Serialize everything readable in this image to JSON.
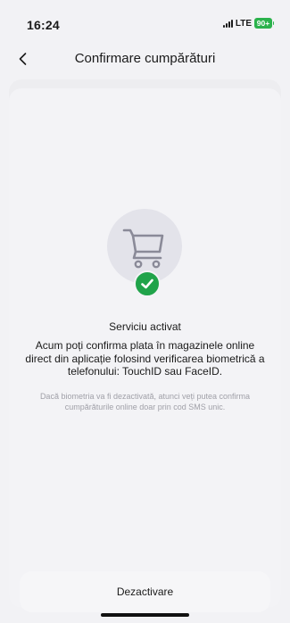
{
  "status_bar": {
    "time": "16:24",
    "network": "LTE",
    "battery": "90+"
  },
  "header": {
    "back_icon": "chevron-left-icon",
    "title": "Confirmare cumpărături"
  },
  "illustration": {
    "main_icon": "shopping-cart-icon",
    "badge_icon": "check-icon",
    "badge_color": "#20a34a"
  },
  "content": {
    "title": "Serviciu activat",
    "description": "Acum poți confirma plata în magazinele online direct din aplicație folosind verificarea biometrică a telefonului: TouchID sau FaceID.",
    "note": "Dacă biometria va fi dezactivată, atunci veți putea confirma cumpărăturile online doar prin cod SMS unic."
  },
  "actions": {
    "deactivate_label": "Dezactivare"
  }
}
